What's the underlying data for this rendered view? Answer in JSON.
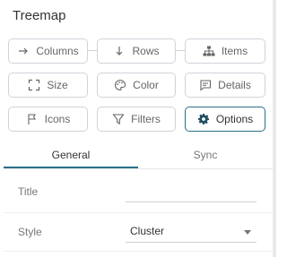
{
  "panel": {
    "title": "Treemap"
  },
  "buttons": {
    "columns": "Columns",
    "rows": "Rows",
    "items": "Items",
    "size": "Size",
    "color": "Color",
    "details": "Details",
    "icons": "Icons",
    "filters": "Filters",
    "options": "Options"
  },
  "tabs": {
    "general": "General",
    "sync": "Sync"
  },
  "form": {
    "title_label": "Title",
    "title_value": "",
    "style_label": "Style",
    "style_value": "Cluster"
  },
  "colors": {
    "accent": "#2a6f88",
    "border": "#cfd4da"
  }
}
